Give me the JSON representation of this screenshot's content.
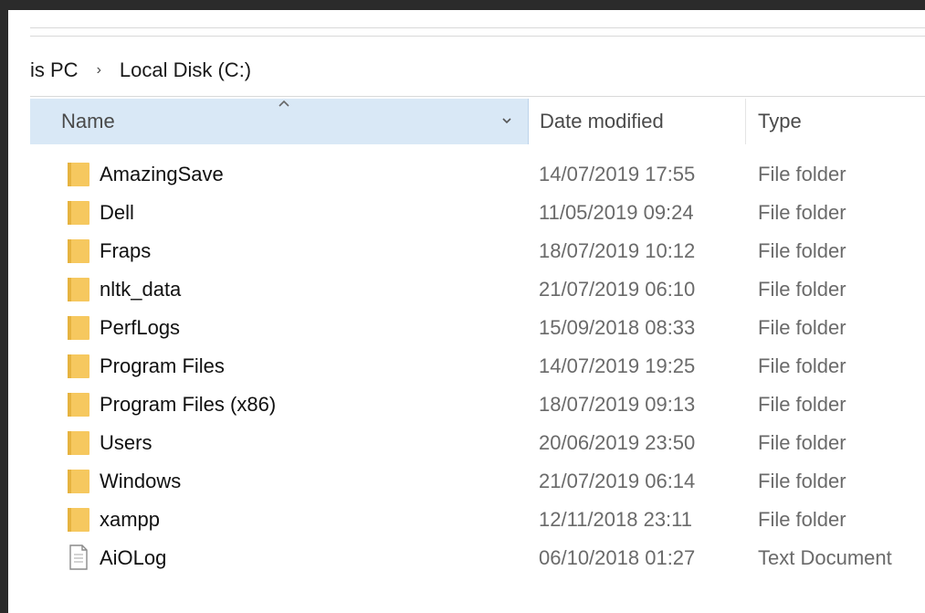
{
  "breadcrumb": {
    "items": [
      "is PC",
      "Local Disk (C:)"
    ],
    "separator": "›"
  },
  "columns": {
    "name": "Name",
    "date_modified": "Date modified",
    "type": "Type"
  },
  "files": [
    {
      "name": "AmazingSave",
      "date": "14/07/2019 17:55",
      "type": "File folder",
      "icon": "folder-icon"
    },
    {
      "name": "Dell",
      "date": "11/05/2019 09:24",
      "type": "File folder",
      "icon": "folder-icon"
    },
    {
      "name": "Fraps",
      "date": "18/07/2019 10:12",
      "type": "File folder",
      "icon": "folder-icon"
    },
    {
      "name": "nltk_data",
      "date": "21/07/2019 06:10",
      "type": "File folder",
      "icon": "folder-icon"
    },
    {
      "name": "PerfLogs",
      "date": "15/09/2018 08:33",
      "type": "File folder",
      "icon": "folder-icon"
    },
    {
      "name": "Program Files",
      "date": "14/07/2019 19:25",
      "type": "File folder",
      "icon": "folder-icon"
    },
    {
      "name": "Program Files (x86)",
      "date": "18/07/2019 09:13",
      "type": "File folder",
      "icon": "folder-icon"
    },
    {
      "name": "Users",
      "date": "20/06/2019 23:50",
      "type": "File folder",
      "icon": "folder-icon"
    },
    {
      "name": "Windows",
      "date": "21/07/2019 06:14",
      "type": "File folder",
      "icon": "folder-icon"
    },
    {
      "name": "xampp",
      "date": "12/11/2018 23:11",
      "type": "File folder",
      "icon": "folder-icon"
    },
    {
      "name": "AiOLog",
      "date": "06/10/2018 01:27",
      "type": "Text Document",
      "icon": "text-document-icon"
    }
  ],
  "colors": {
    "header_selected": "#d9e8f6",
    "folder": "#f6c85f",
    "folder_shade": "#e6b340"
  }
}
